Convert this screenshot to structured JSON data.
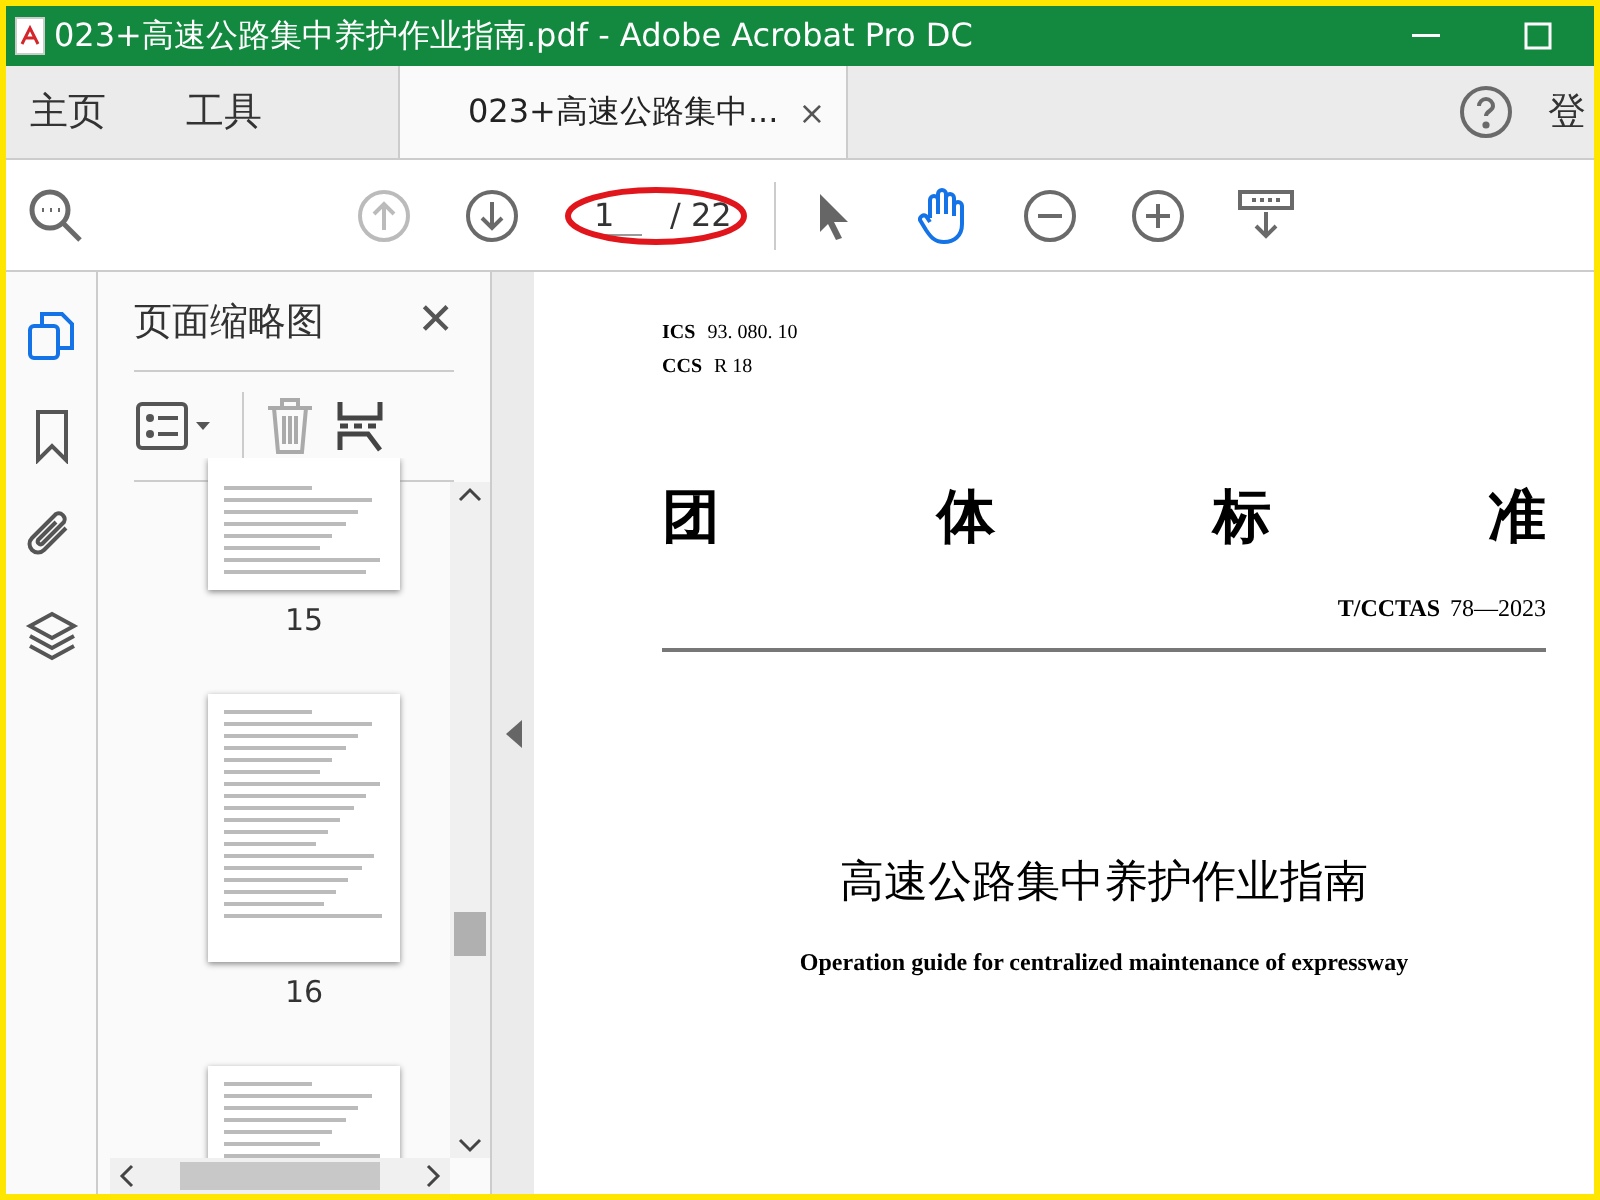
{
  "window": {
    "title": "023+高速公路集中养护作业指南.pdf - Adobe Acrobat Pro DC"
  },
  "nav_tabs": [
    {
      "label": "主页",
      "selected": false
    },
    {
      "label": "工具",
      "selected": false
    }
  ],
  "document_tab": {
    "label": "023+高速公路集中...",
    "close": "×",
    "selected": true
  },
  "account_label": "登",
  "toolbar": {
    "page_number": "1",
    "page_total": "/ 22",
    "prev_disabled": true,
    "next_disabled": false,
    "hand_tool_selected": true,
    "page_annotated": true
  },
  "side_rail": [
    {
      "kind": "pages",
      "selected": true
    },
    {
      "kind": "bookmarks",
      "selected": false
    },
    {
      "kind": "attachments",
      "selected": false
    },
    {
      "kind": "layers",
      "selected": false
    }
  ],
  "thumbnails_panel": {
    "title": "页面缩略图",
    "close": "✕",
    "thumbnails": [
      {
        "label": "15",
        "kind": "top_cut"
      },
      {
        "label": "16",
        "kind": "full"
      },
      {
        "kind": "bottom_cut"
      }
    ]
  },
  "document": {
    "ics": "ICS",
    "ics_code": "93. 080. 10",
    "ccs": "CCS",
    "ccs_code": "R 18",
    "heading": [
      "团",
      "体",
      "标",
      "准"
    ],
    "standard_no": "T/CCTAS",
    "standard_code": "78—2023",
    "title_zh": "高速公路集中养护作业指南",
    "title_en": "Operation guide for centralized maintenance of expressway"
  }
}
